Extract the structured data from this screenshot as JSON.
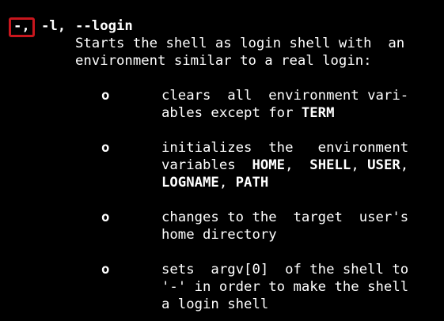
{
  "option": {
    "short_dash": "-,",
    "short_l": "-l,",
    "long": "--login"
  },
  "description": {
    "line1": "Starts the shell as login shell with  an",
    "line2": "environment similar to a real login:"
  },
  "bullet_marker": "o",
  "bullets": [
    {
      "lines": [
        [
          "clears  all  environment vari-"
        ],
        [
          "ables except for ",
          {
            "b": "TERM"
          }
        ]
      ]
    },
    {
      "lines": [
        [
          "initializes  the   environment"
        ],
        [
          "variables  ",
          {
            "b": "HOME"
          },
          ",  ",
          {
            "b": "SHELL"
          },
          ", ",
          {
            "b": "USER"
          },
          ","
        ],
        [
          {
            "b": "LOGNAME"
          },
          ", ",
          {
            "b": "PATH"
          }
        ]
      ]
    },
    {
      "lines": [
        [
          "changes to the  target  user's"
        ],
        [
          "home directory"
        ]
      ]
    },
    {
      "lines": [
        [
          "sets  argv[0]  of the shell to"
        ],
        [
          "'-' in order to make the shell"
        ],
        [
          "a login shell"
        ]
      ]
    }
  ],
  "colors": {
    "background": "#000000",
    "text": "#ffffff",
    "highlight_box": "#c8161d"
  }
}
